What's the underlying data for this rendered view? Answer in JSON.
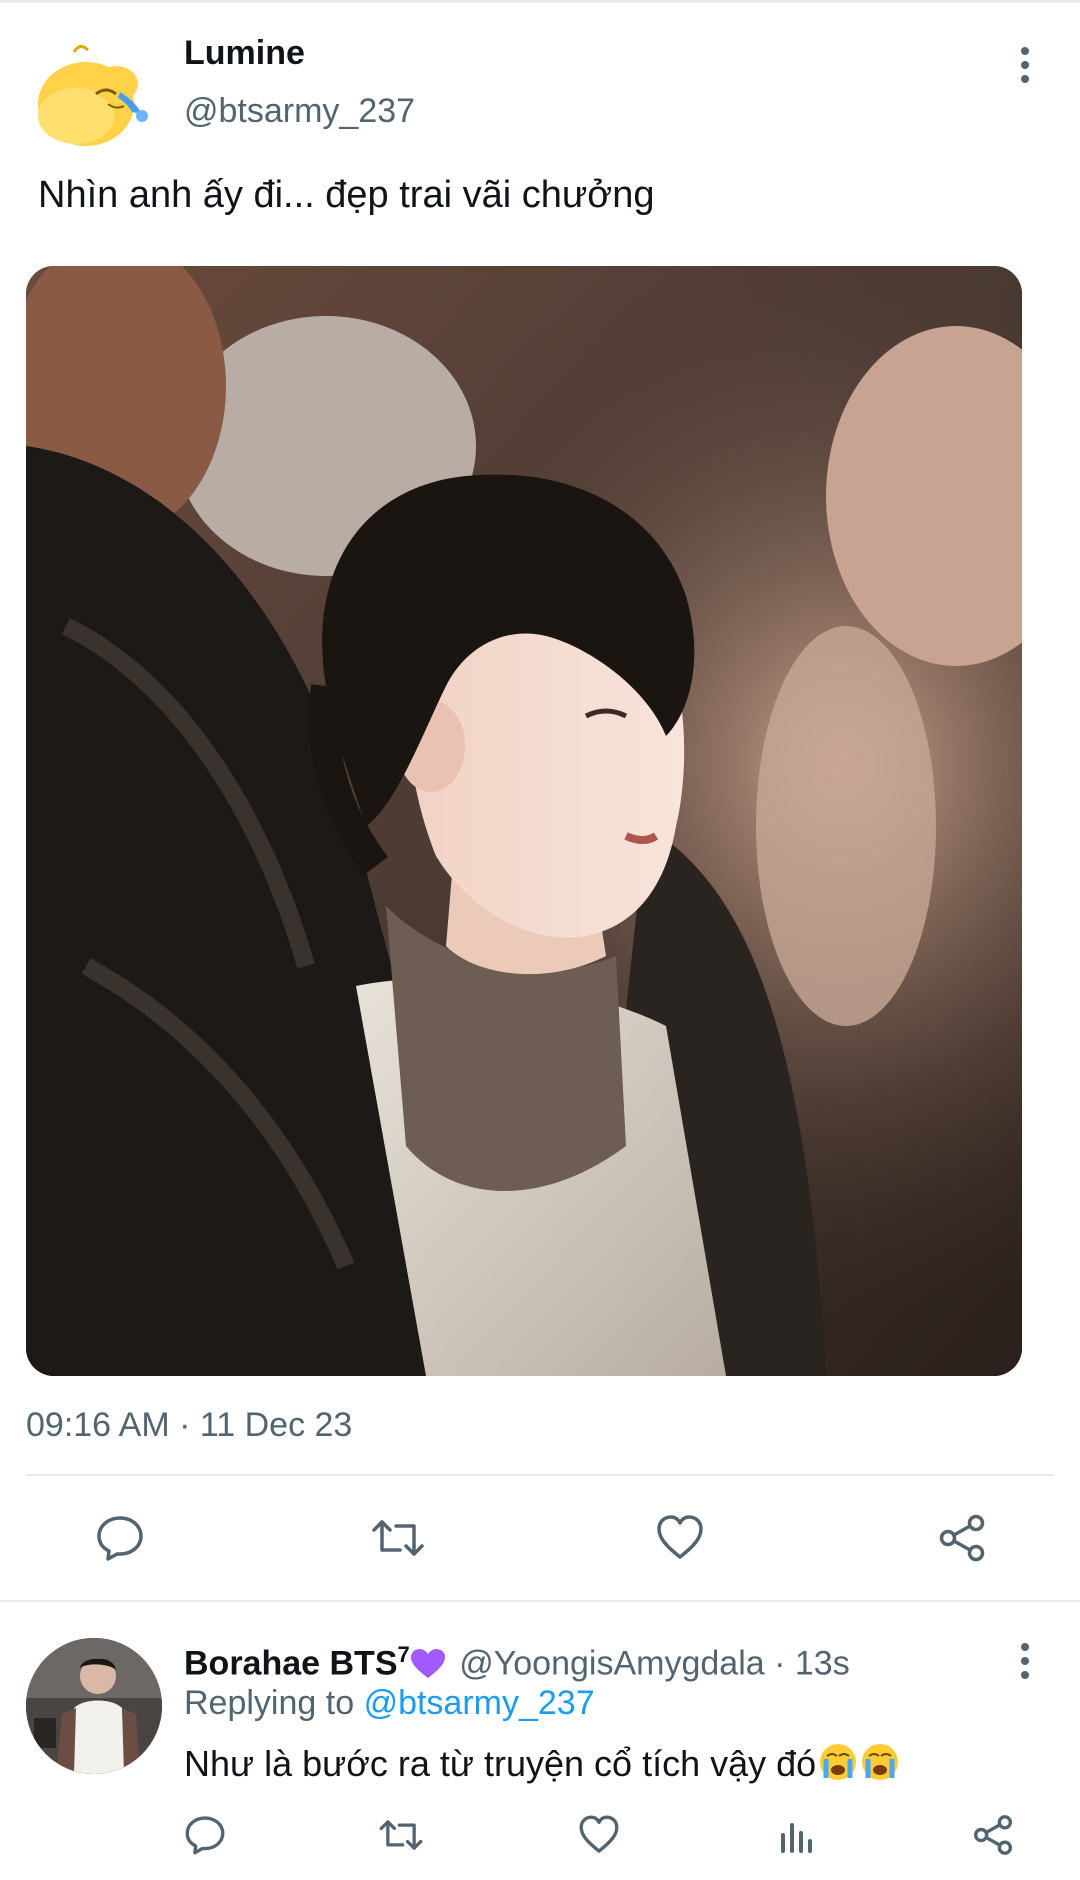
{
  "tweet": {
    "author_name": "Lumine",
    "author_handle": "@btsarmy_237",
    "text": "Nhìn anh ấy đi... đẹp trai vãi chưởng",
    "timestamp": "09:16 AM · 11 Dec 23",
    "avatar_icon": "yellow-duck-crying-avatar",
    "photo": "photo-man-in-crowd"
  },
  "actions": {
    "reply_icon": "comment-icon",
    "retweet_icon": "retweet-icon",
    "like_icon": "heart-icon",
    "share_icon": "share-icon"
  },
  "reply": {
    "author_name": "Borahae BTS",
    "author_badge": "7",
    "author_handle": "@YoongisAmygdala",
    "age": "· 13s",
    "replying_prefix": "Replying to",
    "replying_to": "@btsarmy_237",
    "text": "Như là bước ra từ truyện cổ tích vậy đó",
    "emoji": "loudly-crying-face-icon x2",
    "actions": [
      "comment-icon",
      "retweet-icon",
      "heart-icon",
      "stats-icon",
      "share-icon"
    ]
  },
  "colors": {
    "text": "#0f1419",
    "secondary": "#536471",
    "link": "#1d9bf0",
    "divider": "#e6ecf0",
    "purple_heart": "#a259ff"
  }
}
